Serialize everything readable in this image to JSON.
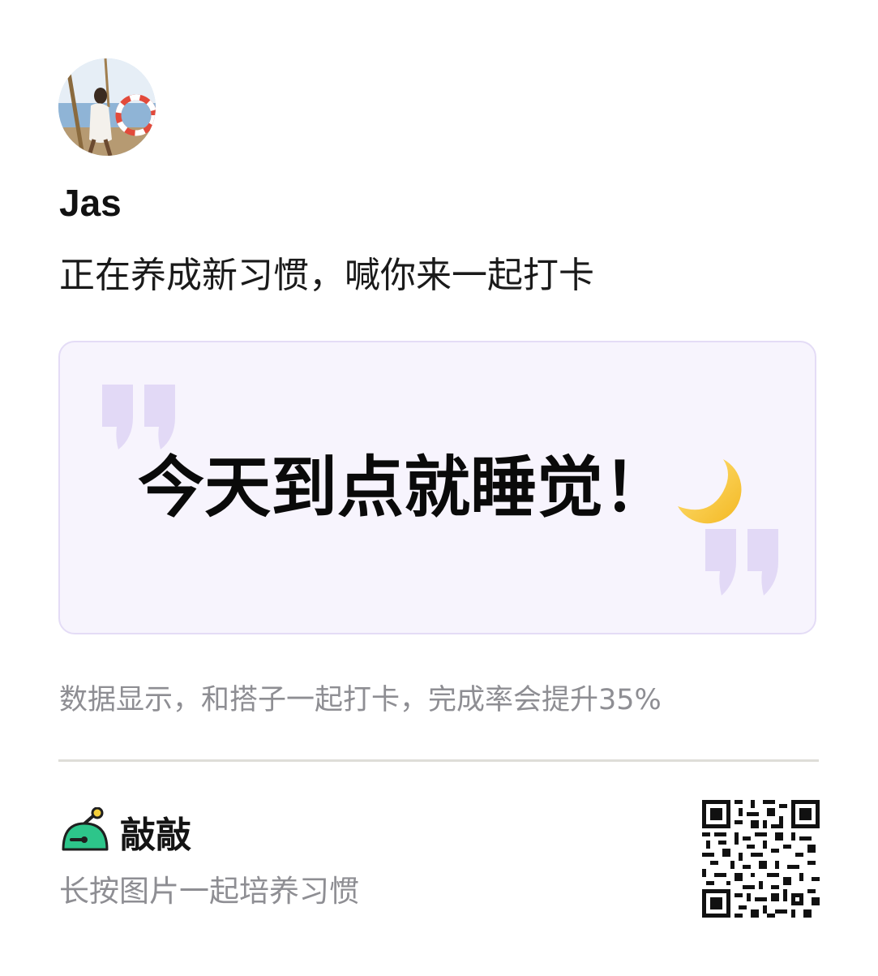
{
  "profile": {
    "avatar_icon": "avatar-photo",
    "name": "Jas",
    "invite_text": "正在养成新习惯，喊你来一起打卡"
  },
  "quote_card": {
    "text": "今天到点就睡觉！",
    "emoji": "🌙",
    "quote_mark_color": "#e2d9f6",
    "background_color": "#f7f4fd",
    "border_color": "#e4dcf6"
  },
  "stat_note": "数据显示，和搭子一起打卡，完成率会提升35%",
  "footer": {
    "app_name": "敲敲",
    "app_icon": "mallet-dome-logo",
    "caption": "长按图片一起培养习惯",
    "qr_icon": "qr-code",
    "brand_color": "#2dc58a"
  }
}
